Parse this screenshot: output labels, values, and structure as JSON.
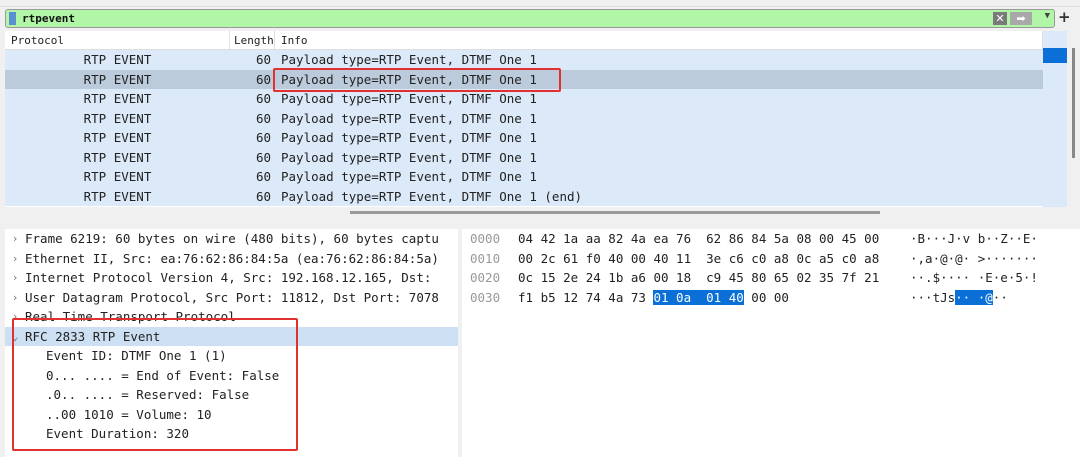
{
  "filter": {
    "value": "rtpevent"
  },
  "packet_list": {
    "columns": [
      "Protocol",
      "Length",
      "Info"
    ],
    "rows": [
      {
        "protocol": "RTP EVENT",
        "length": "60",
        "info": "Payload type=RTP Event, DTMF One 1"
      },
      {
        "protocol": "RTP EVENT",
        "length": "60",
        "info": "Payload type=RTP Event, DTMF One 1"
      },
      {
        "protocol": "RTP EVENT",
        "length": "60",
        "info": "Payload type=RTP Event, DTMF One 1"
      },
      {
        "protocol": "RTP EVENT",
        "length": "60",
        "info": "Payload type=RTP Event, DTMF One 1"
      },
      {
        "protocol": "RTP EVENT",
        "length": "60",
        "info": "Payload type=RTP Event, DTMF One 1"
      },
      {
        "protocol": "RTP EVENT",
        "length": "60",
        "info": "Payload type=RTP Event, DTMF One 1"
      },
      {
        "protocol": "RTP EVENT",
        "length": "60",
        "info": "Payload type=RTP Event, DTMF One 1"
      },
      {
        "protocol": "RTP EVENT",
        "length": "60",
        "info": "Payload type=RTP Event, DTMF One 1 (end)"
      }
    ]
  },
  "details": {
    "top": [
      "Frame 6219: 60 bytes on wire (480 bits), 60 bytes captu",
      "Ethernet II, Src: ea:76:62:86:84:5a (ea:76:62:86:84:5a)",
      "Internet Protocol Version 4, Src: 192.168.12.165, Dst:",
      "User Datagram Protocol, Src Port: 11812, Dst Port: 7078",
      "Real Time Transport Protocol",
      "RFC 2833 RTP Event"
    ],
    "children": [
      "Event ID: DTMF One 1 (1)",
      "0... .... = End of Event: False",
      ".0.. .... = Reserved: False",
      "..00 1010 = Volume: 10",
      "Event Duration: 320"
    ]
  },
  "hex": [
    {
      "off": "0000",
      "pre": "04 42 1a aa 82 4a ea 76  62 86 84 5a 08 00 45 00",
      "hl": "",
      "post": "",
      "asc_pre": "·B···J·v b··Z··E·",
      "asc_hl": "",
      "asc_post": ""
    },
    {
      "off": "0010",
      "pre": "00 2c 61 f0 40 00 40 11  3e c6 c0 a8 0c a5 c0 a8",
      "hl": "",
      "post": "",
      "asc_pre": "·,a·@·@· >·······",
      "asc_hl": "",
      "asc_post": ""
    },
    {
      "off": "0020",
      "pre": "0c 15 2e 24 1b a6 00 18  c9 45 80 65 02 35 7f 21",
      "hl": "",
      "post": "",
      "asc_pre": "··.$···· ·E·e·5·!",
      "asc_hl": "",
      "asc_post": ""
    },
    {
      "off": "0030",
      "pre": "f1 b5 12 74 4a 73 ",
      "hl": "01 0a  01 40",
      "post": " 00 00",
      "asc_pre": "···tJs",
      "asc_hl": "·· ·@",
      "asc_post": "··"
    }
  ]
}
